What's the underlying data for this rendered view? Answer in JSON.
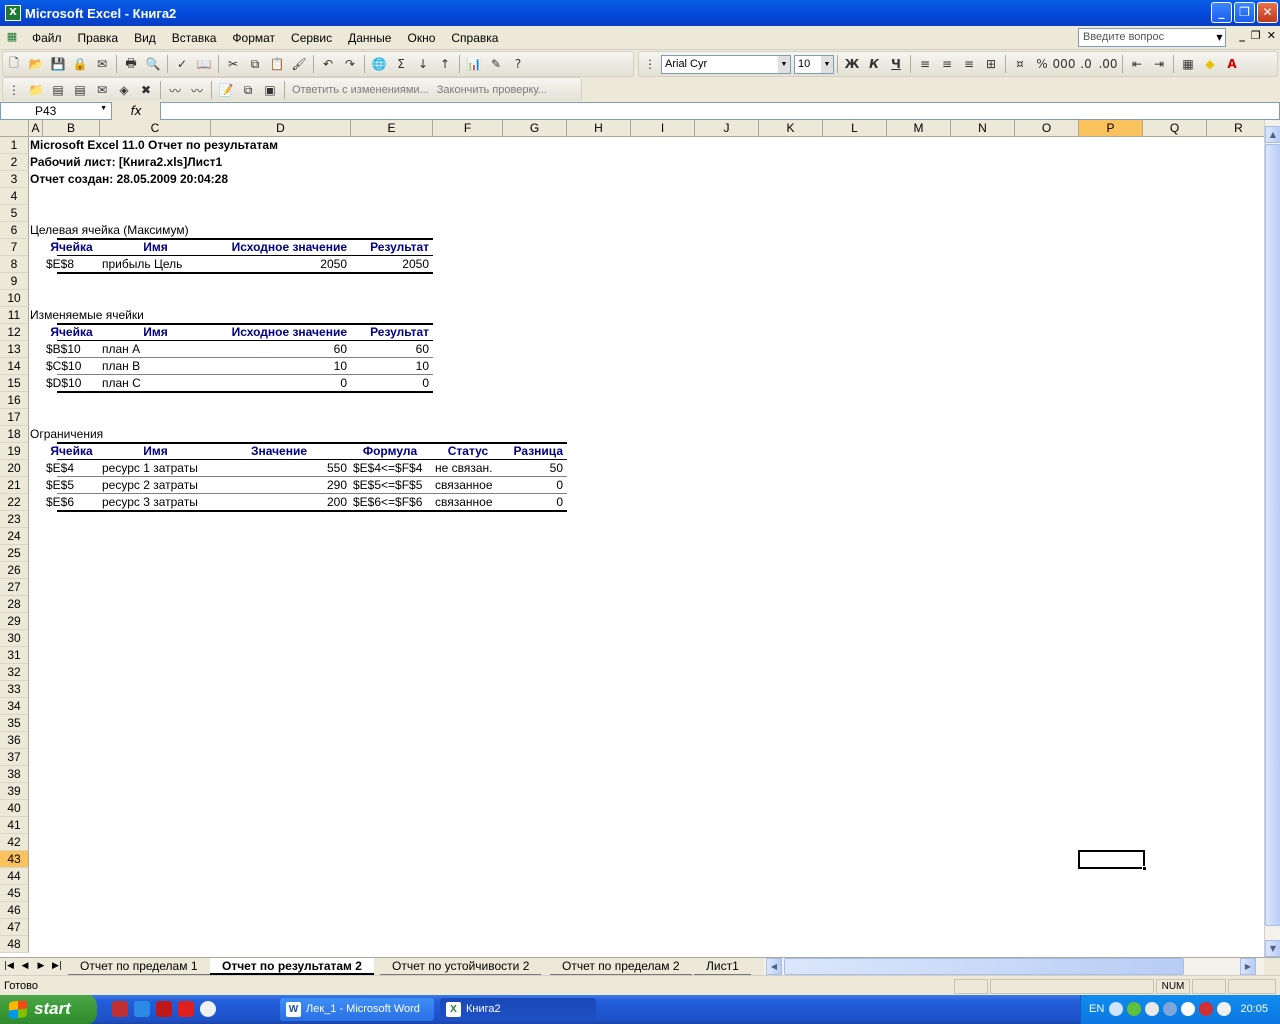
{
  "window": {
    "title": "Microsoft Excel - Книга2"
  },
  "menu": {
    "items": [
      "Файл",
      "Правка",
      "Вид",
      "Вставка",
      "Формат",
      "Сервис",
      "Данные",
      "Окно",
      "Справка"
    ],
    "help_placeholder": "Введите вопрос"
  },
  "format_toolbar": {
    "font_name": "Arial Cyr",
    "font_size": "10",
    "bold": "Ж",
    "italic": "К",
    "underline": "Ч"
  },
  "review_toolbar": {
    "reply": "Ответить с изменениями...",
    "end_review": "Закончить проверку..."
  },
  "formula_bar": {
    "name_box": "P43",
    "fx": "fx",
    "formula": ""
  },
  "columns": [
    "A",
    "B",
    "C",
    "D",
    "E",
    "F",
    "G",
    "H",
    "I",
    "J",
    "K",
    "L",
    "M",
    "N",
    "O",
    "P",
    "Q",
    "R"
  ],
  "active_column": "P",
  "active_row": 43,
  "rows": [
    "1",
    "2",
    "3",
    "4",
    "5",
    "6",
    "7",
    "8",
    "9",
    "10",
    "11",
    "12",
    "13",
    "14",
    "15",
    "16",
    "17",
    "18",
    "19",
    "20",
    "21",
    "22",
    "23",
    "24",
    "25",
    "26",
    "27",
    "28",
    "29",
    "30",
    "31",
    "32",
    "33",
    "34",
    "35",
    "36",
    "37",
    "38",
    "39",
    "40",
    "41",
    "42",
    "43",
    "44",
    "45",
    "46",
    "47",
    "48"
  ],
  "report": {
    "line1": "Microsoft Excel 11.0 Отчет по результатам",
    "line2": "Рабочий лист: [Книга2.xls]Лист1",
    "line3": "Отчет создан: 28.05.2009 20:04:28",
    "target": {
      "section": "Целевая ячейка (Максимум)",
      "headers": [
        "Ячейка",
        "Имя",
        "Исходное значение",
        "Результат"
      ],
      "rows": [
        [
          "$E$8",
          "прибыль Цель",
          "2050",
          "2050"
        ]
      ]
    },
    "changing": {
      "section": "Изменяемые ячейки",
      "headers": [
        "Ячейка",
        "Имя",
        "Исходное значение",
        "Результат"
      ],
      "rows": [
        [
          "$B$10",
          "план A",
          "60",
          "60"
        ],
        [
          "$C$10",
          "план B",
          "10",
          "10"
        ],
        [
          "$D$10",
          "план C",
          "0",
          "0"
        ]
      ]
    },
    "constraints": {
      "section": "Ограничения",
      "headers": [
        "Ячейка",
        "Имя",
        "Значение",
        "Формула",
        "Статус",
        "Разница"
      ],
      "rows": [
        [
          "$E$4",
          "ресурс 1 затраты",
          "550",
          "$E$4<=$F$4",
          "не связан.",
          "50"
        ],
        [
          "$E$5",
          "ресурс 2 затраты",
          "290",
          "$E$5<=$F$5",
          "связанное",
          "0"
        ],
        [
          "$E$6",
          "ресурс 3 затраты",
          "200",
          "$E$6<=$F$6",
          "связанное",
          "0"
        ]
      ]
    }
  },
  "sheet_tabs": [
    "Отчет по пределам 1",
    "Отчет по результатам 2",
    "Отчет по устойчивости 2",
    "Отчет по пределам 2",
    "Лист1"
  ],
  "active_tab": "Отчет по результатам 2",
  "status": {
    "text": "Готово",
    "num": "NUM"
  },
  "taskbar": {
    "start": "start",
    "items": [
      "Лек_1 - Microsoft Word",
      "Книга2"
    ],
    "lang": "EN",
    "clock": "20:05"
  }
}
